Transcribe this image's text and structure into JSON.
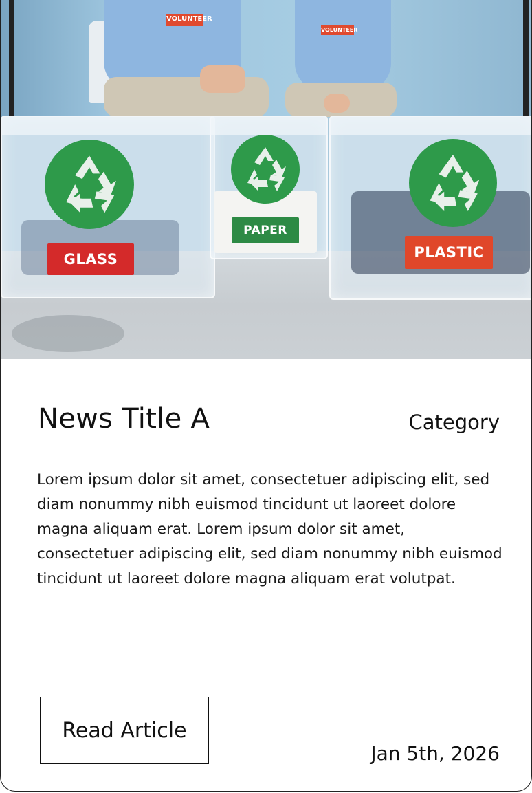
{
  "hero": {
    "bin_labels": [
      "GLASS",
      "PAPER",
      "PLASTIC"
    ],
    "shirt_labels": [
      "VOLUNTEER",
      "VOLUNTEER"
    ],
    "colors": {
      "recycle_green": "#2e9a4a",
      "glass_red": "#d42a2a",
      "paper_green": "#2d8a45",
      "plastic_orange": "#e0472a"
    }
  },
  "article": {
    "title": "News Title A",
    "category": "Category",
    "body": "Lorem ipsum dolor sit amet, consectetuer adipiscing elit, sed diam nonummy nibh euismod tincidunt ut laoreet dolore magna aliquam erat. Lorem ipsum dolor sit amet, consectetuer adipiscing elit, sed diam nonummy nibh euismod tincidunt ut laoreet dolore magna aliquam erat volutpat.",
    "read_button_label": "Read Article",
    "date": "Jan 5th, 2026"
  }
}
